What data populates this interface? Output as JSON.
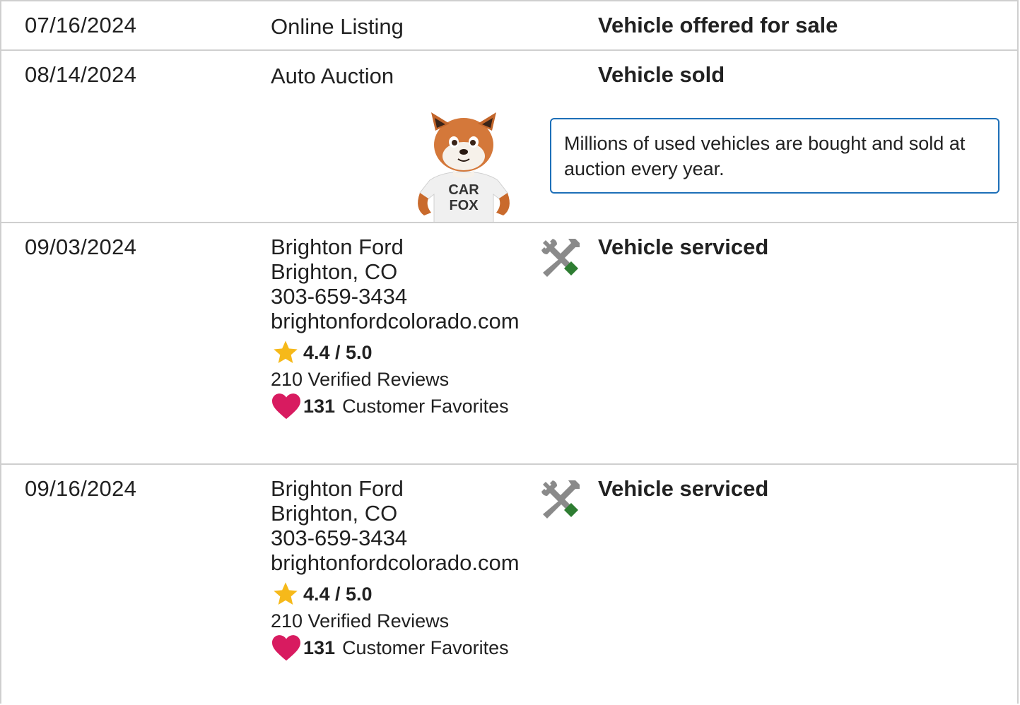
{
  "rows": [
    {
      "date": "07/16/2024",
      "source": "Online Listing",
      "comment": "Vehicle offered for sale"
    },
    {
      "date": "08/14/2024",
      "source": "Auto Auction",
      "comment": "Vehicle sold",
      "tip": "Millions of used vehicles are bought and sold at auction every year.",
      "mascot_text": "CAR FOX"
    },
    {
      "date": "09/03/2024",
      "dealer_name": "Brighton Ford",
      "dealer_location": "Brighton, CO",
      "dealer_phone": "303-659-3434",
      "dealer_website": "brightonfordcolorado.com",
      "rating": "4.4 / 5.0",
      "reviews": "210 Verified Reviews",
      "favorites_count": "131",
      "favorites_label": "Customer Favorites",
      "comment": "Vehicle serviced",
      "icon": "service-tools-icon"
    },
    {
      "date": "09/16/2024",
      "dealer_name": "Brighton Ford",
      "dealer_location": "Brighton, CO",
      "dealer_phone": "303-659-3434",
      "dealer_website": "brightonfordcolorado.com",
      "rating": "4.4 / 5.0",
      "reviews": "210 Verified Reviews",
      "favorites_count": "131",
      "favorites_label": "Customer Favorites",
      "comment": "Vehicle serviced",
      "icon": "service-tools-icon"
    }
  ],
  "colors": {
    "border": "#cfcfcf",
    "tip_border": "#1d6fb8",
    "star": "#f6b91a",
    "heart": "#d81b60",
    "tool_grey": "#8a8a8a",
    "tool_green": "#2e7d32"
  }
}
